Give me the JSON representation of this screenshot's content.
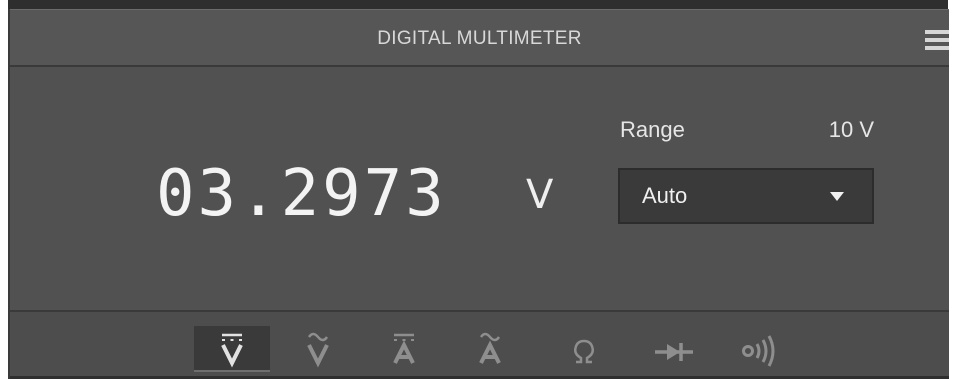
{
  "header": {
    "title": "DIGITAL MULTIMETER",
    "menu_icon": "hamburger-menu-icon"
  },
  "display": {
    "reading": "03.2973",
    "unit": "V"
  },
  "range": {
    "label": "Range",
    "value": "10 V",
    "selected": "Auto"
  },
  "modes": [
    {
      "id": "dc-voltage",
      "icon": "dc-voltage-icon",
      "active": true
    },
    {
      "id": "ac-voltage",
      "icon": "ac-voltage-icon",
      "active": false
    },
    {
      "id": "dc-current",
      "icon": "dc-current-icon",
      "active": false
    },
    {
      "id": "ac-current",
      "icon": "ac-current-icon",
      "active": false
    },
    {
      "id": "resistance",
      "icon": "ohm-icon",
      "active": false
    },
    {
      "id": "diode",
      "icon": "diode-icon",
      "active": false
    },
    {
      "id": "continuity",
      "icon": "continuity-icon",
      "active": false
    }
  ],
  "colors": {
    "panel": "#515151",
    "title_bar": "#565656",
    "dropdown": "#3a3a3a",
    "active_mode_icon": "#e2e2e2",
    "inactive_mode_icon": "#8e8e8e",
    "text": "#e6e6e6"
  }
}
